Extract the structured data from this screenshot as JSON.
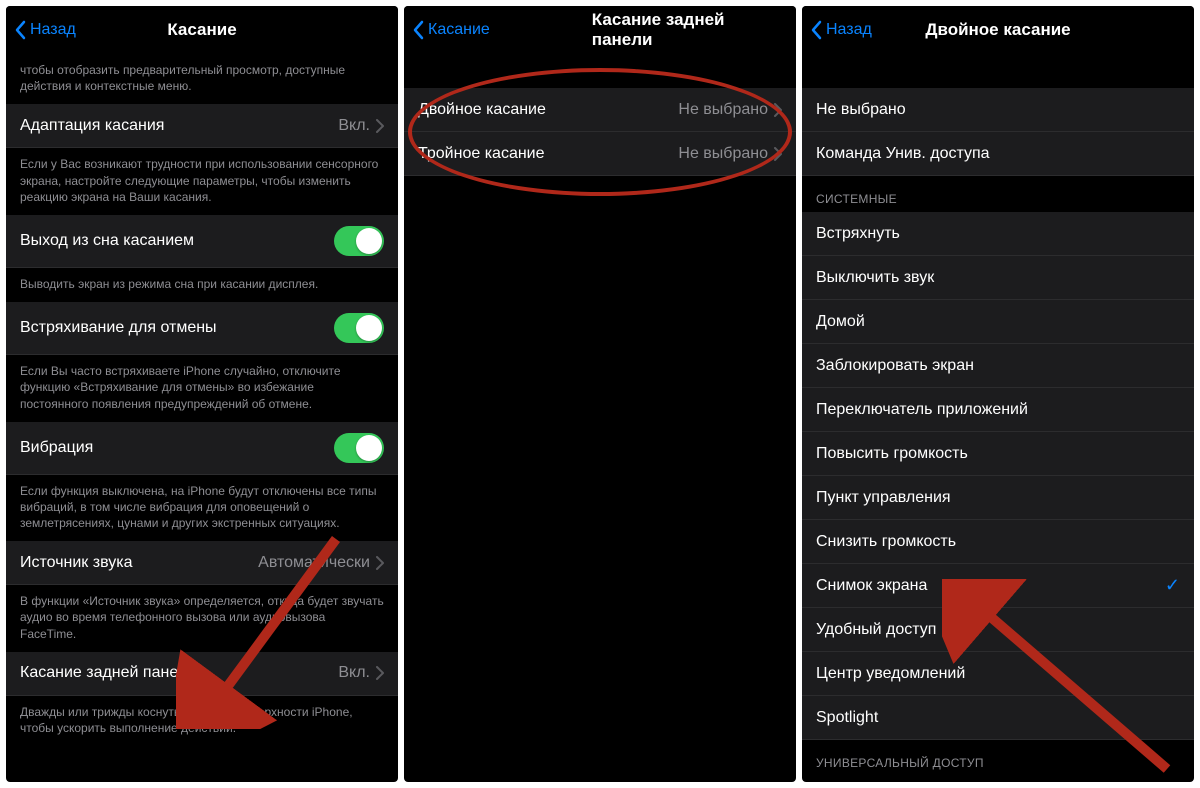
{
  "screen1": {
    "back": "Назад",
    "title": "Касание",
    "topFooter": "чтобы отобразить предварительный просмотр, доступные действия и контекстные меню.",
    "rows": {
      "adapt": {
        "label": "Адаптация касания",
        "value": "Вкл."
      },
      "adaptFooter": "Если у Вас возникают трудности при использовании сенсорного экрана, настройте следующие параметры, чтобы изменить реакцию экрана на Ваши касания.",
      "wake": {
        "label": "Выход из сна касанием"
      },
      "wakeFooter": "Выводить экран из режима сна при касании дисплея.",
      "shake": {
        "label": "Встряхивание для отмены"
      },
      "shakeFooter": "Если Вы часто встряхиваете iPhone случайно, отключите функцию «Встряхивание для отмены» во избежание постоянного появления предупреждений об отмене.",
      "vibration": {
        "label": "Вибрация"
      },
      "vibrationFooter": "Если функция выключена, на iPhone будут отключены все типы вибраций, в том числе вибрация для оповещений о землетрясениях, цунами и других экстренных ситуациях.",
      "soundSource": {
        "label": "Источник звука",
        "value": "Автоматически"
      },
      "soundFooter": "В функции «Источник звука» определяется, откуда будет звучать аудио во время телефонного вызова или аудиовызова FaceTime.",
      "backTap": {
        "label": "Касание задней панели",
        "value": "Вкл."
      },
      "backTapFooter": "Дважды или трижды коснуться задней поверхности iPhone, чтобы ускорить выполнение действий."
    }
  },
  "screen2": {
    "back": "Касание",
    "title": "Касание задней панели",
    "rows": {
      "double": {
        "label": "Двойное касание",
        "value": "Не выбрано"
      },
      "triple": {
        "label": "Тройное касание",
        "value": "Не выбрано"
      }
    }
  },
  "screen3": {
    "back": "Назад",
    "title": "Двойное касание",
    "group1": [
      "Не выбрано",
      "Команда Унив. доступа"
    ],
    "systemHeader": "СИСТЕМНЫЕ",
    "systemItems": [
      "Встряхнуть",
      "Выключить звук",
      "Домой",
      "Заблокировать экран",
      "Переключатель приложений",
      "Повысить громкость",
      "Пункт управления",
      "Снизить громкость",
      "Снимок экрана",
      "Удобный доступ",
      "Центр уведомлений",
      "Spotlight"
    ],
    "selectedIndex": 8,
    "accessHeader": "УНИВЕРСАЛЬНЫЙ ДОСТУП"
  }
}
